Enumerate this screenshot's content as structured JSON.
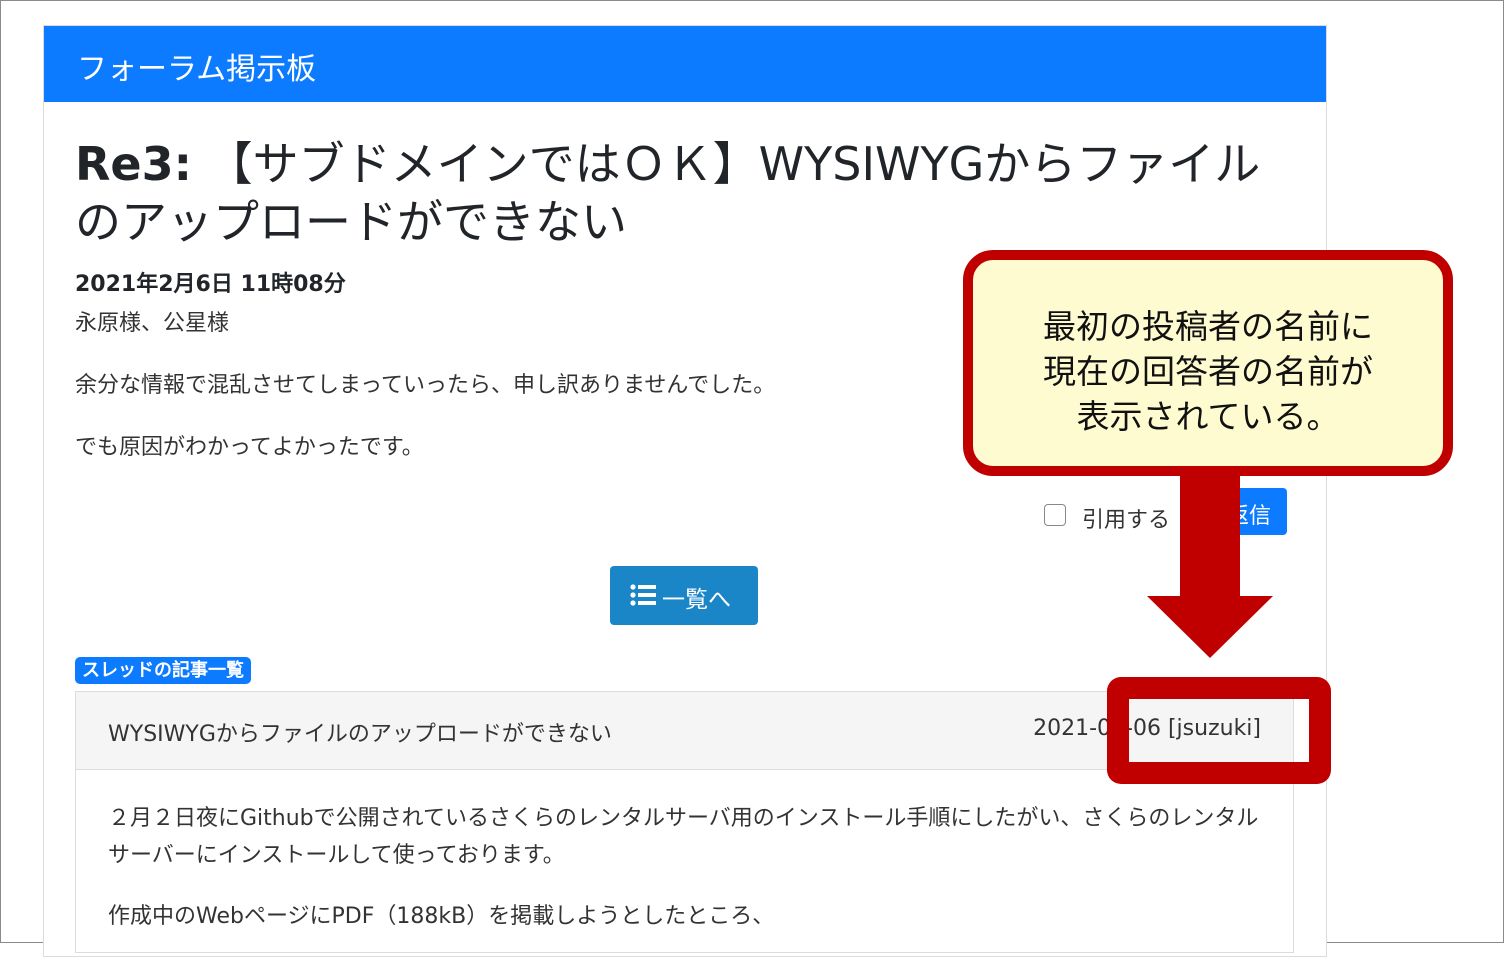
{
  "header": {
    "title": "フォーラム掲示板"
  },
  "post": {
    "title_prefix": "Re3:",
    "title_rest": "【サブドメインではＯＫ】WYSIWYGからファイルのアップロードができない",
    "date": "2021年2月6日 11時08分",
    "greeting": "永原様、公星様",
    "body": [
      "余分な情報で混乱させてしまっていったら、申し訳ありませんでした。",
      "でも原因がわかってよかったです。"
    ],
    "quote_label": "引用する",
    "reply_label": "返信"
  },
  "list_button": {
    "label": "一覧へ",
    "icon": "list-icon"
  },
  "thread": {
    "badge": "スレッドの記事一覧",
    "entry_title": "WYSIWYGからファイルのアップロードができない",
    "entry_meta": "2021-02-06 [jsuzuki]",
    "body": [
      "２月２日夜にGithubで公開されているさくらのレンタルサーバ用のインストール手順にしたがい、さくらのレンタルサーバーにインストールして使っております。",
      "作成中のWebページにPDF（188kB）を掲載しようとしたところ、"
    ]
  },
  "annotation": {
    "lines": [
      "最初の投稿者の名前に",
      "現在の回答者の名前が",
      "表示されている。"
    ],
    "color": "#c00000"
  }
}
